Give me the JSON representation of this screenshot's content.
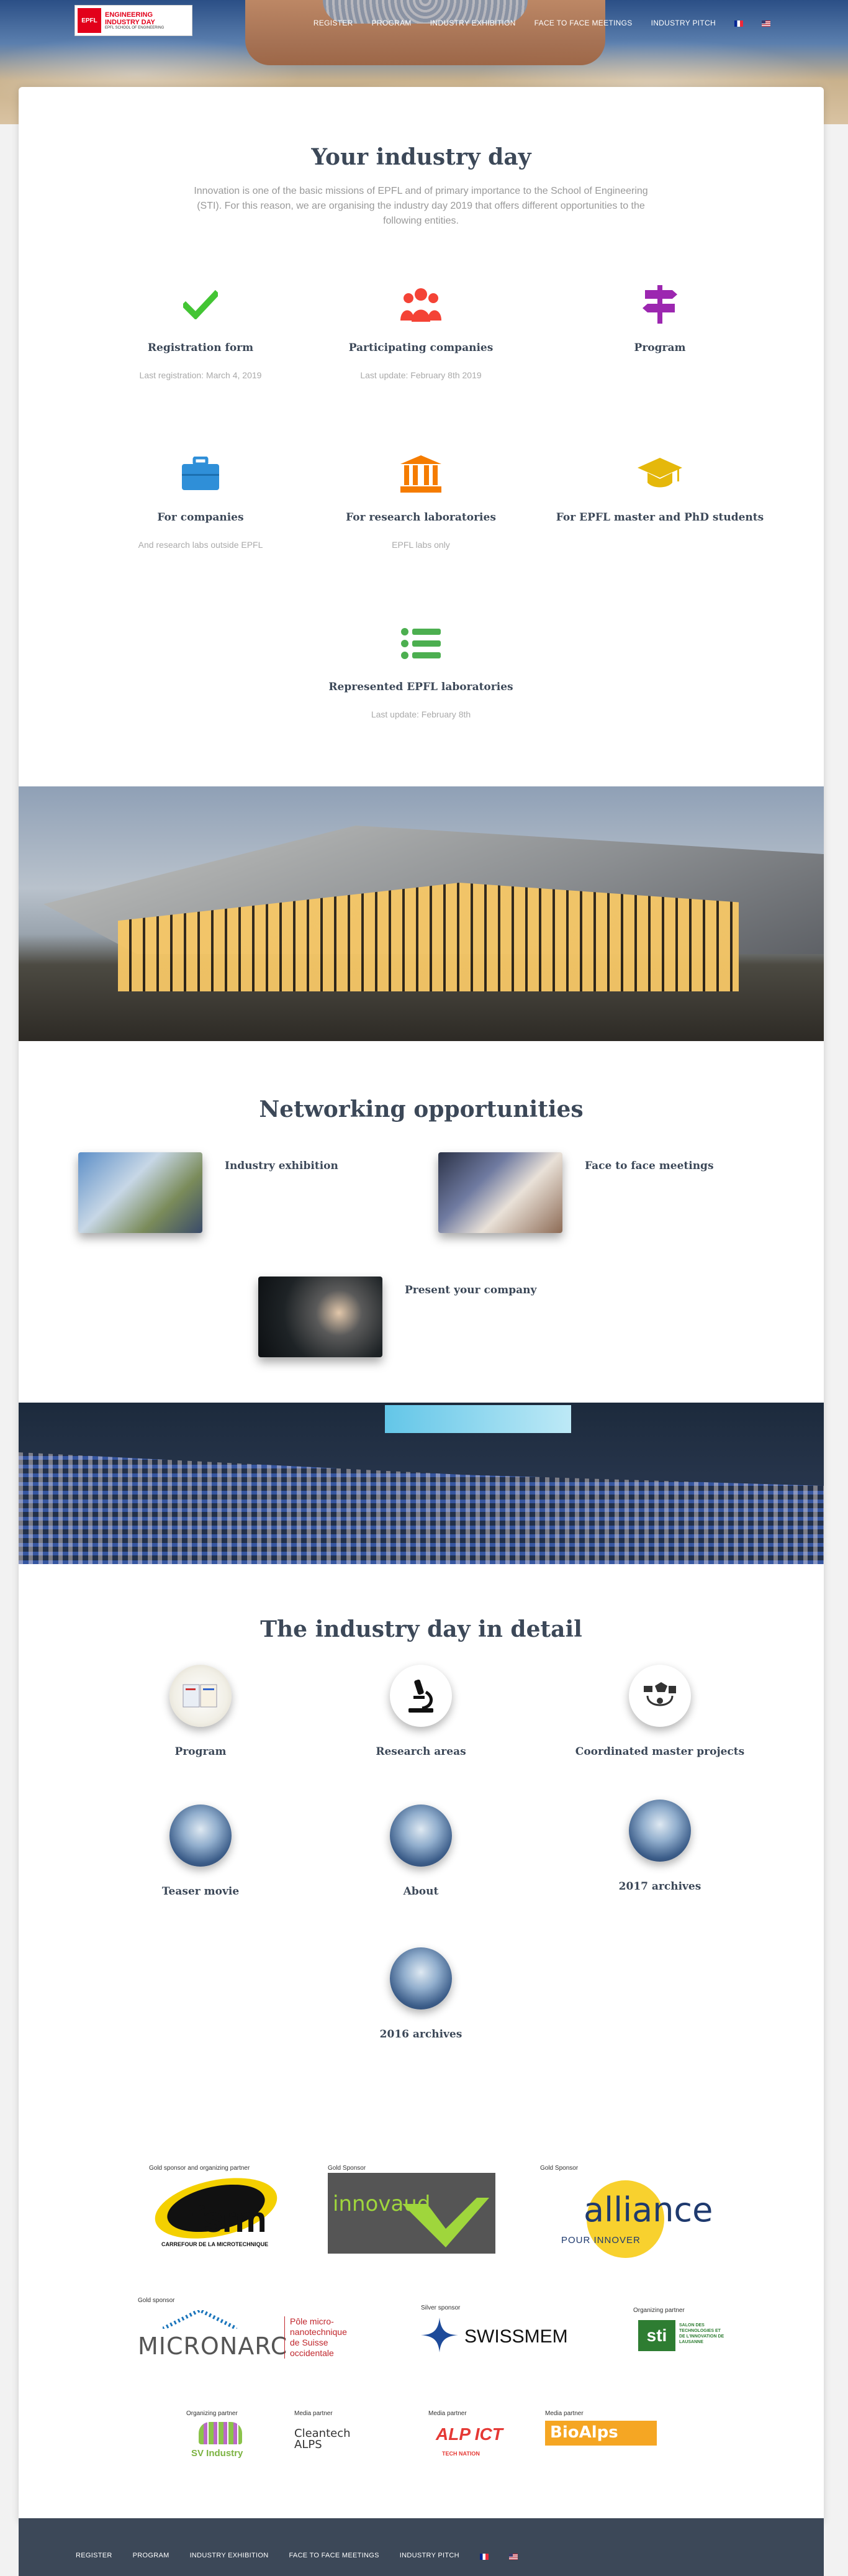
{
  "header": {
    "logo_mark": "EPFL",
    "logo_title_1": "ENGINEERING",
    "logo_title_2": "INDUSTRY DAY",
    "logo_sub": "EPFL SCHOOL OF ENGINEERING",
    "nav": [
      "REGISTER",
      "PROGRAM",
      "INDUSTRY EXHIBITION",
      "FACE TO FACE MEETINGS",
      "INDUSTRY PITCH"
    ]
  },
  "intro": {
    "title": "Your industry day",
    "text": "Innovation is one of the basic missions of EPFL and of primary importance to the School of Engineering (STI). For this reason, we are organising the industry day 2019 that offers different opportunities to the following entities."
  },
  "features": [
    {
      "icon": "check-icon",
      "title": "Registration form",
      "subtitle": "Last registration: March 4, 2019",
      "color": "#4caf50"
    },
    {
      "icon": "users-icon",
      "title": "Participating companies",
      "subtitle": "Last update: February 8th 2019",
      "color": "#f44336"
    },
    {
      "icon": "signpost-icon",
      "title": "Program",
      "subtitle": "",
      "color": "#9c27b0"
    },
    {
      "icon": "briefcase-icon",
      "title": "For companies",
      "subtitle": "And research labs outside EPFL",
      "color": "#2196f3"
    },
    {
      "icon": "institution-icon",
      "title": "For research laboratories",
      "subtitle": "EPFL labs only",
      "color": "#ff9800"
    },
    {
      "icon": "graduation-cap-icon",
      "title": "For EPFL master and PhD students",
      "subtitle": "",
      "color": "#f5c518"
    },
    {
      "icon": "list-icon",
      "title": "Represented EPFL laboratories",
      "subtitle": "Last update: February 8th",
      "color": "#4caf50"
    }
  ],
  "networking": {
    "title": "Networking opportunities",
    "items": [
      "Industry exhibition",
      "Face to face meetings",
      "Present your company"
    ]
  },
  "details": {
    "title": "The industry day in detail",
    "items": [
      "Program",
      "Research areas",
      "Coordinated master projects",
      "Teaser movie",
      "About",
      "2017 archives",
      "2016 archives"
    ]
  },
  "sponsors": {
    "fsrm_caption": "Gold sponsor and organizing partner",
    "fsrm_name": "fsrm",
    "fsrm_sub": "CARREFOUR DE LA MICROTECHNIQUE",
    "innovaud_caption": "Gold Sponsor",
    "innovaud_name": "innovaud",
    "alliance_caption": "Gold Sponsor",
    "alliance_name": "alliance",
    "alliance_sub": "POUR INNOVER",
    "micronarc_caption": "Gold sponsor",
    "micronarc_name": "MICRONARC",
    "micronarc_sub": "Pôle micro-nanotechnique de Suisse occidentale",
    "swissmem_caption": "Silver sponsor",
    "swissmem_name": "SWISSMEM",
    "sti_caption": "Organizing partner",
    "sti_name": "sti",
    "sti_sub": "SALON DES TECHNOLOGIES ET DE L'INNOVATION DE LAUSANNE",
    "sv_caption": "Organizing partner",
    "sv_name": "SV Industry",
    "cleantech_caption": "Media partner",
    "cleantech_name": "Cleantech ALPS",
    "alp_caption": "Media partner",
    "alp_name": "ALP ICT",
    "alp_sub": "TECH NATION",
    "bioalps_caption": "Media partner",
    "bioalps_name": "BioAlps"
  },
  "footer": {
    "nav": [
      "REGISTER",
      "PROGRAM",
      "INDUSTRY EXHIBITION",
      "FACE TO FACE MEETINGS",
      "INDUSTRY PITCH"
    ]
  }
}
